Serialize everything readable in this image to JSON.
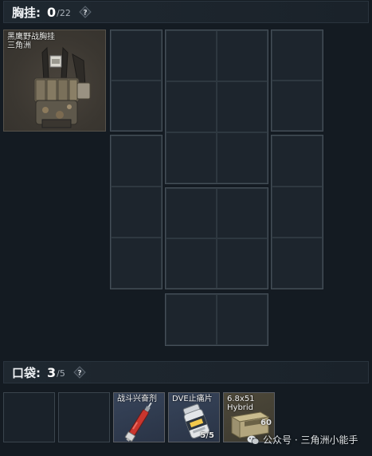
{
  "chest_rig": {
    "title": "胸挂:",
    "count": "0",
    "max": "/22",
    "help_label": "?",
    "equipped_item": {
      "name_line1": "黑鹰野战胸挂",
      "name_line2": "三角洲",
      "icon": "chest-rig-vest"
    }
  },
  "pockets": {
    "title": "口袋:",
    "count": "3",
    "max": "/5",
    "help_label": "?",
    "items": [
      {
        "label": "",
        "count": "",
        "icon": "empty-slot"
      },
      {
        "label": "",
        "count": "",
        "icon": "empty-slot"
      },
      {
        "label": "战斗兴奋剂",
        "count": "",
        "icon": "syringe-icon"
      },
      {
        "label": "DVE止痛片",
        "count": "5/5",
        "icon": "pill-bottle-icon"
      },
      {
        "label": "6.8x51 Hybrid",
        "count": "60",
        "icon": "ammo-box-icon"
      }
    ]
  },
  "watermark": {
    "text": "公众号 · 三角洲小能手"
  },
  "colors": {
    "background": "#141b22",
    "slot_border": "#3a444d",
    "item_blue": "#2f3a4c",
    "item_tan": "#4a4538"
  }
}
